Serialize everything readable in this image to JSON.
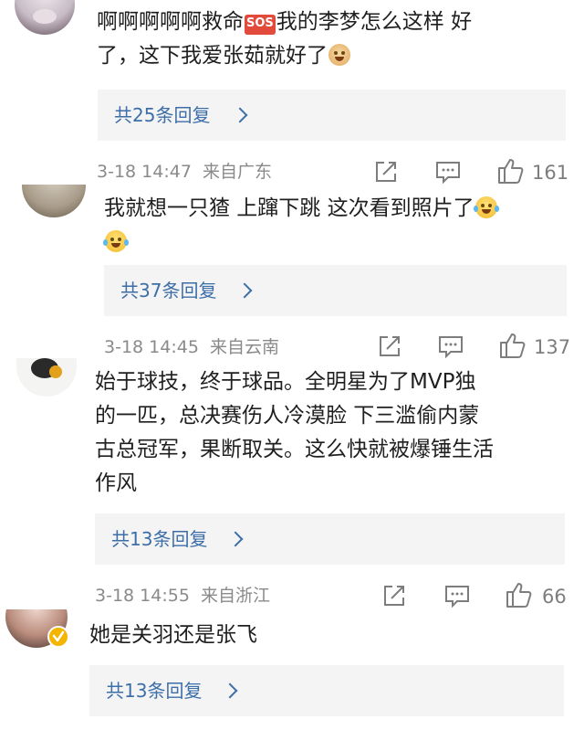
{
  "comments": [
    {
      "lines": [
        "啊啊啊啊啊救命",
        "我的李梦怎么这样 好",
        "了，这下我爱张茹就好了"
      ],
      "sos_badge": "SOS",
      "reply_label": "共25条回复",
      "time": "3-18 14:47",
      "location": "来自广东",
      "like_count": "161"
    },
    {
      "lines": [
        "我就想一只猹 上蹿下跳 这次看到照片了"
      ],
      "reply_label": "共37条回复",
      "time": "3-18 14:45",
      "location": "来自云南",
      "like_count": "137"
    },
    {
      "lines": [
        "始于球技，终于球品。全明星为了MVP独",
        "的一匹，总决赛伤人冷漠脸 下三滥偷内蒙",
        "古总冠军，果断取关。这么快就被爆锤生活",
        "作风"
      ],
      "reply_label": "共13条回复",
      "time": "3-18 14:55",
      "location": "来自浙江",
      "like_count": "66"
    },
    {
      "lines": [
        "她是关羽还是张飞"
      ],
      "reply_label": "共13条回复"
    }
  ],
  "icons": {
    "share": "share-icon",
    "comment": "comment-icon",
    "like": "thumbs-up-icon",
    "verified": "verified-badge-icon"
  },
  "colors": {
    "link": "#3d6ea8",
    "meta": "#8a8a8a",
    "reply_bg": "#f4f4f4",
    "verified": "#f5b400"
  }
}
